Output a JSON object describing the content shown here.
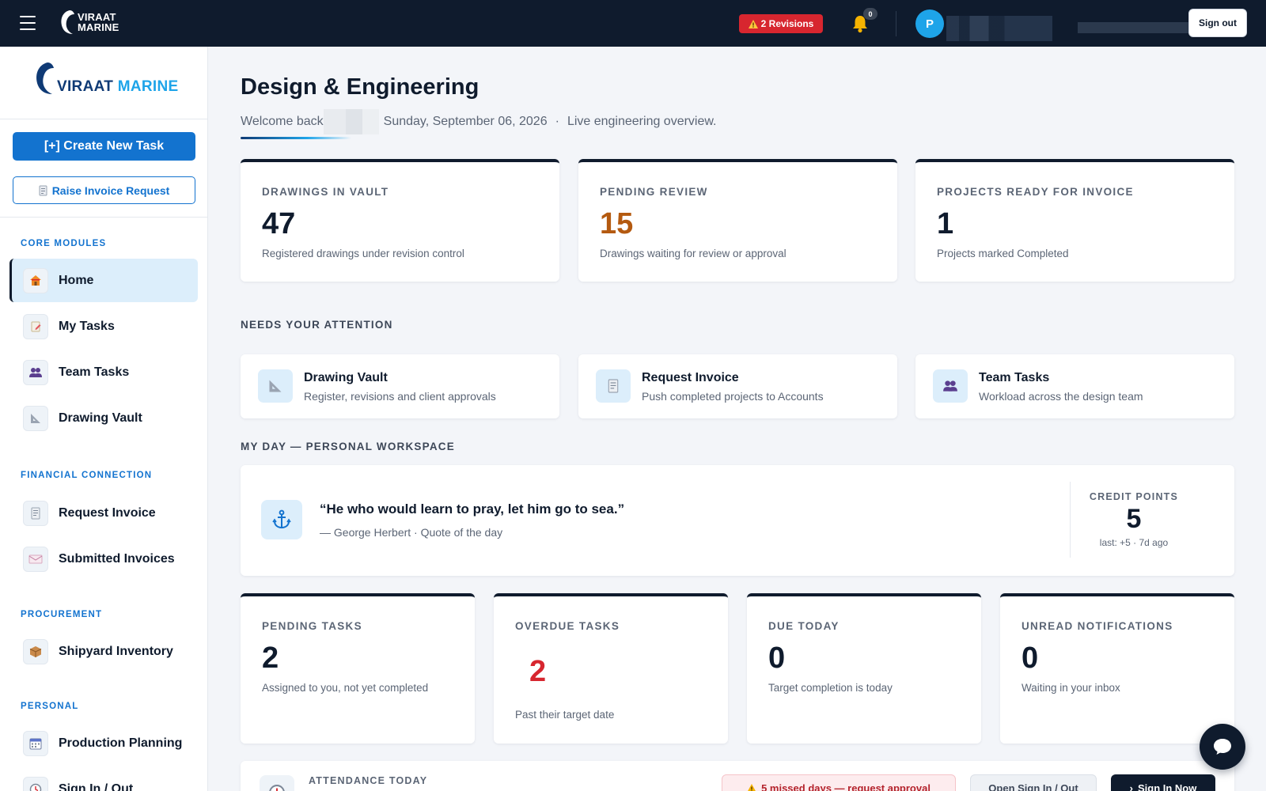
{
  "topbar": {
    "logo_line1": "VIRAAT",
    "logo_line2": "MARINE",
    "revisions_label": "2 Revisions",
    "notifications_count": "0",
    "avatar_initial": "P",
    "signout_label": "Sign out"
  },
  "sidebar": {
    "logo_part1": "VIRAAT",
    "logo_part2": "MARINE",
    "create_task_label": "[+] Create New Task",
    "raise_invoice_label": "Raise Invoice Request",
    "sections": [
      {
        "label": "CORE MODULES"
      },
      {
        "label": "FINANCIAL CONNECTION"
      },
      {
        "label": "PROCUREMENT"
      },
      {
        "label": "PERSONAL"
      }
    ],
    "items": [
      {
        "label": "Home",
        "icon": "house-icon",
        "active": true
      },
      {
        "label": "My Tasks",
        "icon": "notepad-icon"
      },
      {
        "label": "Team Tasks",
        "icon": "people-icon"
      },
      {
        "label": "Drawing Vault",
        "icon": "triangle-ruler-icon"
      },
      {
        "label": "Request Invoice",
        "icon": "receipt-icon"
      },
      {
        "label": "Submitted Invoices",
        "icon": "envelope-icon"
      },
      {
        "label": "Shipyard Inventory",
        "icon": "package-icon"
      },
      {
        "label": "Production Planning",
        "icon": "calendar-icon"
      },
      {
        "label": "Sign In / Out",
        "icon": "clock-icon"
      }
    ]
  },
  "header": {
    "title": "Design & Engineering",
    "welcome": "Welcome back",
    "date": "Sunday, September 06, 2026",
    "separator": "·",
    "tagline": "Live engineering overview."
  },
  "stats_top": [
    {
      "label": "DRAWINGS IN VAULT",
      "value": "47",
      "sub": "Registered drawings under revision control",
      "color": "#0f1b2d"
    },
    {
      "label": "PENDING REVIEW",
      "value": "15",
      "sub": "Drawings waiting for review or approval",
      "color": "#b45a10"
    },
    {
      "label": "PROJECTS READY FOR INVOICE",
      "value": "1",
      "sub": "Projects marked Completed",
      "color": "#0f1b2d"
    }
  ],
  "attention": {
    "heading": "NEEDS YOUR ATTENTION",
    "items": [
      {
        "title": "Drawing Vault",
        "sub": "Register, revisions and client approvals",
        "icon": "triangle-ruler-icon"
      },
      {
        "title": "Request Invoice",
        "sub": "Push completed projects to Accounts",
        "icon": "receipt-icon"
      },
      {
        "title": "Team Tasks",
        "sub": "Workload across the design team",
        "icon": "people-icon"
      }
    ]
  },
  "my_day": {
    "heading": "MY DAY — PERSONAL WORKSPACE",
    "quote": "“He who would learn to pray, let him go to sea.”",
    "author": "— George Herbert · Quote of the day",
    "credit_label": "CREDIT POINTS",
    "credit_value": "5",
    "credit_sub": "last: +5 · 7d ago"
  },
  "stats_bottom": [
    {
      "label": "PENDING TASKS",
      "value": "2",
      "sub": "Assigned to you, not yet completed",
      "color": "#0f1b2d"
    },
    {
      "label": "OVERDUE TASKS",
      "value": "2",
      "sub": "Past their target date",
      "color": "#d7262f"
    },
    {
      "label": "DUE TODAY",
      "value": "0",
      "sub": "Target completion is today",
      "color": "#0f1b2d"
    },
    {
      "label": "UNREAD NOTIFICATIONS",
      "value": "0",
      "sub": "Waiting in your inbox",
      "color": "#0f1b2d"
    }
  ],
  "attendance": {
    "label": "ATTENDANCE TODAY",
    "missed_label": "5 missed days — request approval",
    "open_label": "Open Sign In / Out",
    "sign_now_label": "Sign In Now"
  },
  "colors": {
    "navy": "#0f1b2d",
    "brand_blue": "#1373cf",
    "accent_cyan": "#1ea4e9",
    "alert_red": "#d7262f",
    "amber": "#b45a10"
  }
}
